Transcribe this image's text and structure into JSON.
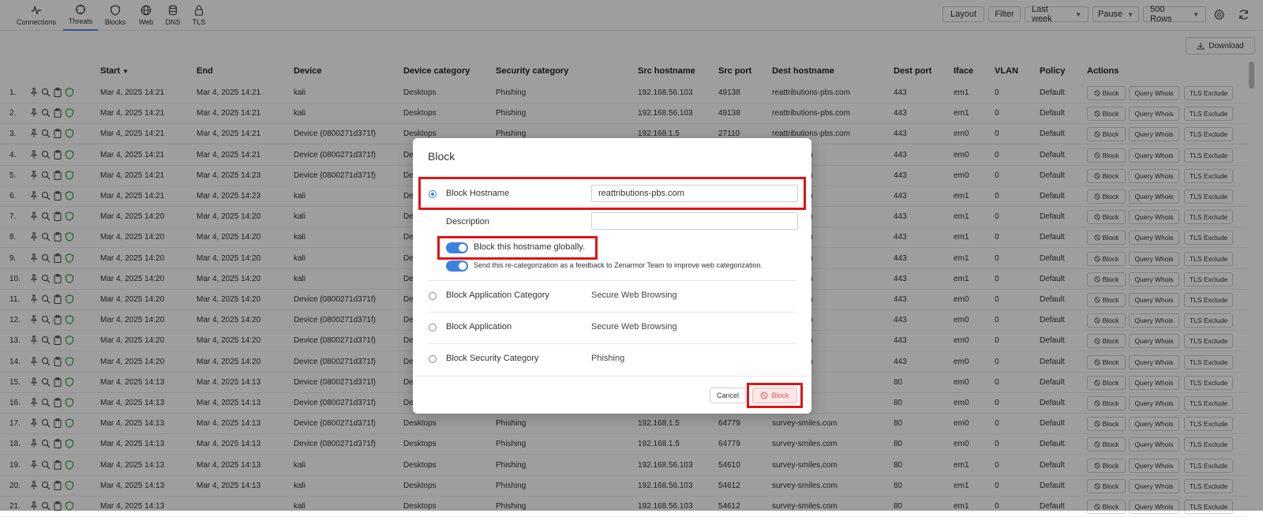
{
  "nav": {
    "tabs": [
      {
        "label": "Connections",
        "icon": "activity-icon"
      },
      {
        "label": "Threats",
        "icon": "crosshair-icon"
      },
      {
        "label": "Blocks",
        "icon": "shield-icon"
      },
      {
        "label": "Web",
        "icon": "globe-icon"
      },
      {
        "label": "DNS",
        "icon": "database-icon"
      },
      {
        "label": "TLS",
        "icon": "lock-icon"
      }
    ],
    "active_tab": "Threats"
  },
  "toolbar": {
    "layout": "Layout",
    "filter": "Filter",
    "period": "Last week",
    "pause": "Pause",
    "rows": "500 Rows",
    "download": "Download"
  },
  "table": {
    "headers": [
      "Start",
      "End",
      "Device",
      "Device category",
      "Security category",
      "Src hostname",
      "Src port",
      "Dest hostname",
      "Dest port",
      "Iface",
      "VLAN",
      "Policy",
      "Actions"
    ],
    "sort_indicator": "▼",
    "action_labels": {
      "block": "Block",
      "whois": "Query Whois",
      "tls": "TLS Exclude"
    },
    "rows": [
      {
        "n": "1.",
        "start": "Mar 4, 2025 14:21",
        "end": "Mar 4, 2025 14:21",
        "device": "kali",
        "devcat": "Desktops",
        "seccat": "Phishing",
        "src": "192.168.56.103",
        "sport": "49138",
        "dest": "reattributions-pbs.com",
        "dport": "443",
        "iface": "em1",
        "vlan": "0",
        "policy": "Default"
      },
      {
        "n": "2.",
        "start": "Mar 4, 2025 14:21",
        "end": "Mar 4, 2025 14:21",
        "device": "kali",
        "devcat": "Desktops",
        "seccat": "Phishing",
        "src": "192.168.56.103",
        "sport": "49138",
        "dest": "reattributions-pbs.com",
        "dport": "443",
        "iface": "em1",
        "vlan": "0",
        "policy": "Default"
      },
      {
        "n": "3.",
        "start": "Mar 4, 2025 14:21",
        "end": "Mar 4, 2025 14:21",
        "device": "Device (0800271d371f)",
        "devcat": "Desktops",
        "seccat": "Phishing",
        "src": "192.168.1.5",
        "sport": "27110",
        "dest": "reattributions-pbs.com",
        "dport": "443",
        "iface": "em0",
        "vlan": "0",
        "policy": "Default"
      },
      {
        "n": "4.",
        "start": "Mar 4, 2025 14:21",
        "end": "Mar 4, 2025 14:21",
        "device": "Device (0800271d371f)",
        "devcat": "De",
        "seccat": "",
        "src": "",
        "sport": "",
        "dest": "ns-pbs.com",
        "dport": "443",
        "iface": "em0",
        "vlan": "0",
        "policy": "Default"
      },
      {
        "n": "5.",
        "start": "Mar 4, 2025 14:21",
        "end": "Mar 4, 2025 14:23",
        "device": "Device (0800271d371f)",
        "devcat": "De",
        "seccat": "",
        "src": "",
        "sport": "",
        "dest": "ns-pbs.com",
        "dport": "443",
        "iface": "em0",
        "vlan": "0",
        "policy": "Default"
      },
      {
        "n": "6.",
        "start": "Mar 4, 2025 14:21",
        "end": "Mar 4, 2025 14:23",
        "device": "kali",
        "devcat": "De",
        "seccat": "",
        "src": "",
        "sport": "",
        "dest": "ns-pbs.com",
        "dport": "443",
        "iface": "em1",
        "vlan": "0",
        "policy": "Default"
      },
      {
        "n": "7.",
        "start": "Mar 4, 2025 14:20",
        "end": "Mar 4, 2025 14:20",
        "device": "kali",
        "devcat": "De",
        "seccat": "",
        "src": "",
        "sport": "",
        "dest": "ns-pbs.com",
        "dport": "443",
        "iface": "em1",
        "vlan": "0",
        "policy": "Default"
      },
      {
        "n": "8.",
        "start": "Mar 4, 2025 14:20",
        "end": "Mar 4, 2025 14:20",
        "device": "kali",
        "devcat": "De",
        "seccat": "",
        "src": "",
        "sport": "",
        "dest": "ns-pbs.com",
        "dport": "443",
        "iface": "em1",
        "vlan": "0",
        "policy": "Default"
      },
      {
        "n": "9.",
        "start": "Mar 4, 2025 14:20",
        "end": "Mar 4, 2025 14:20",
        "device": "kali",
        "devcat": "De",
        "seccat": "",
        "src": "",
        "sport": "",
        "dest": "ns-pbs.com",
        "dport": "443",
        "iface": "em1",
        "vlan": "0",
        "policy": "Default"
      },
      {
        "n": "10.",
        "start": "Mar 4, 2025 14:20",
        "end": "Mar 4, 2025 14:20",
        "device": "kali",
        "devcat": "De",
        "seccat": "",
        "src": "",
        "sport": "",
        "dest": "ns-pbs.com",
        "dport": "443",
        "iface": "em1",
        "vlan": "0",
        "policy": "Default"
      },
      {
        "n": "11.",
        "start": "Mar 4, 2025 14:20",
        "end": "Mar 4, 2025 14:20",
        "device": "Device (0800271d371f)",
        "devcat": "De",
        "seccat": "",
        "src": "",
        "sport": "",
        "dest": "ns-pbs.com",
        "dport": "443",
        "iface": "em0",
        "vlan": "0",
        "policy": "Default"
      },
      {
        "n": "12.",
        "start": "Mar 4, 2025 14:20",
        "end": "Mar 4, 2025 14:20",
        "device": "Device (0800271d371f)",
        "devcat": "De",
        "seccat": "",
        "src": "",
        "sport": "",
        "dest": "ns-pbs.com",
        "dport": "443",
        "iface": "em0",
        "vlan": "0",
        "policy": "Default"
      },
      {
        "n": "13.",
        "start": "Mar 4, 2025 14:20",
        "end": "Mar 4, 2025 14:20",
        "device": "Device (0800271d371f)",
        "devcat": "De",
        "seccat": "",
        "src": "",
        "sport": "",
        "dest": "ns-pbs.com",
        "dport": "443",
        "iface": "em0",
        "vlan": "0",
        "policy": "Default"
      },
      {
        "n": "14.",
        "start": "Mar 4, 2025 14:20",
        "end": "Mar 4, 2025 14:20",
        "device": "Device (0800271d371f)",
        "devcat": "De",
        "seccat": "",
        "src": "",
        "sport": "",
        "dest": "ns-pbs.com",
        "dport": "443",
        "iface": "em0",
        "vlan": "0",
        "policy": "Default"
      },
      {
        "n": "15.",
        "start": "Mar 4, 2025 14:13",
        "end": "Mar 4, 2025 14:13",
        "device": "Device (0800271d371f)",
        "devcat": "De",
        "seccat": "",
        "src": "",
        "sport": "",
        "dest": "iles.com",
        "dport": "80",
        "iface": "em0",
        "vlan": "0",
        "policy": "Default"
      },
      {
        "n": "16.",
        "start": "Mar 4, 2025 14:13",
        "end": "Mar 4, 2025 14:13",
        "device": "Device (0800271d371f)",
        "devcat": "De",
        "seccat": "",
        "src": "",
        "sport": "",
        "dest": "iles.com",
        "dport": "80",
        "iface": "em0",
        "vlan": "0",
        "policy": "Default"
      },
      {
        "n": "17.",
        "start": "Mar 4, 2025 14:13",
        "end": "Mar 4, 2025 14:13",
        "device": "Device (0800271d371f)",
        "devcat": "Desktops",
        "seccat": "Phishing",
        "src": "192.168.1.5",
        "sport": "64779",
        "dest": "survey-smiles.com",
        "dport": "80",
        "iface": "em0",
        "vlan": "0",
        "policy": "Default"
      },
      {
        "n": "18.",
        "start": "Mar 4, 2025 14:13",
        "end": "Mar 4, 2025 14:13",
        "device": "Device (0800271d371f)",
        "devcat": "Desktops",
        "seccat": "Phishing",
        "src": "192.168.1.5",
        "sport": "64779",
        "dest": "survey-smiles.com",
        "dport": "80",
        "iface": "em0",
        "vlan": "0",
        "policy": "Default"
      },
      {
        "n": "19.",
        "start": "Mar 4, 2025 14:13",
        "end": "Mar 4, 2025 14:13",
        "device": "kali",
        "devcat": "Desktops",
        "seccat": "Phishing",
        "src": "192.168.56.103",
        "sport": "54610",
        "dest": "survey-smiles.com",
        "dport": "80",
        "iface": "em1",
        "vlan": "0",
        "policy": "Default"
      },
      {
        "n": "20.",
        "start": "Mar 4, 2025 14:13",
        "end": "Mar 4, 2025 14:13",
        "device": "kali",
        "devcat": "Desktops",
        "seccat": "Phishing",
        "src": "192.168.56.103",
        "sport": "54612",
        "dest": "survey-smiles.com",
        "dport": "80",
        "iface": "em1",
        "vlan": "0",
        "policy": "Default"
      },
      {
        "n": "21.",
        "start": "Mar 4, 2025 14:13",
        "end": "",
        "device": "kali",
        "devcat": "Desktops",
        "seccat": "Phishing",
        "src": "192.168.56.103",
        "sport": "54612",
        "dest": "survey-smiles.com",
        "dport": "80",
        "iface": "em1",
        "vlan": "0",
        "policy": "Default"
      }
    ]
  },
  "modal": {
    "title": "Block",
    "hostname_label": "Block Hostname",
    "hostname_value": "reattributions-pbs.com",
    "description_label": "Description",
    "description_value": "",
    "global_toggle_label": "Block this hostname globally.",
    "feedback_toggle_label": "Send this re-categorization as a feedback to Zenarmor Team to improve web categorization.",
    "app_category_label": "Block Application Category",
    "app_category_value": "Secure Web Browsing",
    "application_label": "Block Application",
    "application_value": "Secure Web Browsing",
    "security_category_label": "Block Security Category",
    "security_category_value": "Phishing",
    "cancel": "Cancel",
    "block": "Block"
  },
  "colors": {
    "accent": "#3b82e0",
    "highlight": "#e01414",
    "shield": "#2e9e4f",
    "danger": "#e05050"
  }
}
